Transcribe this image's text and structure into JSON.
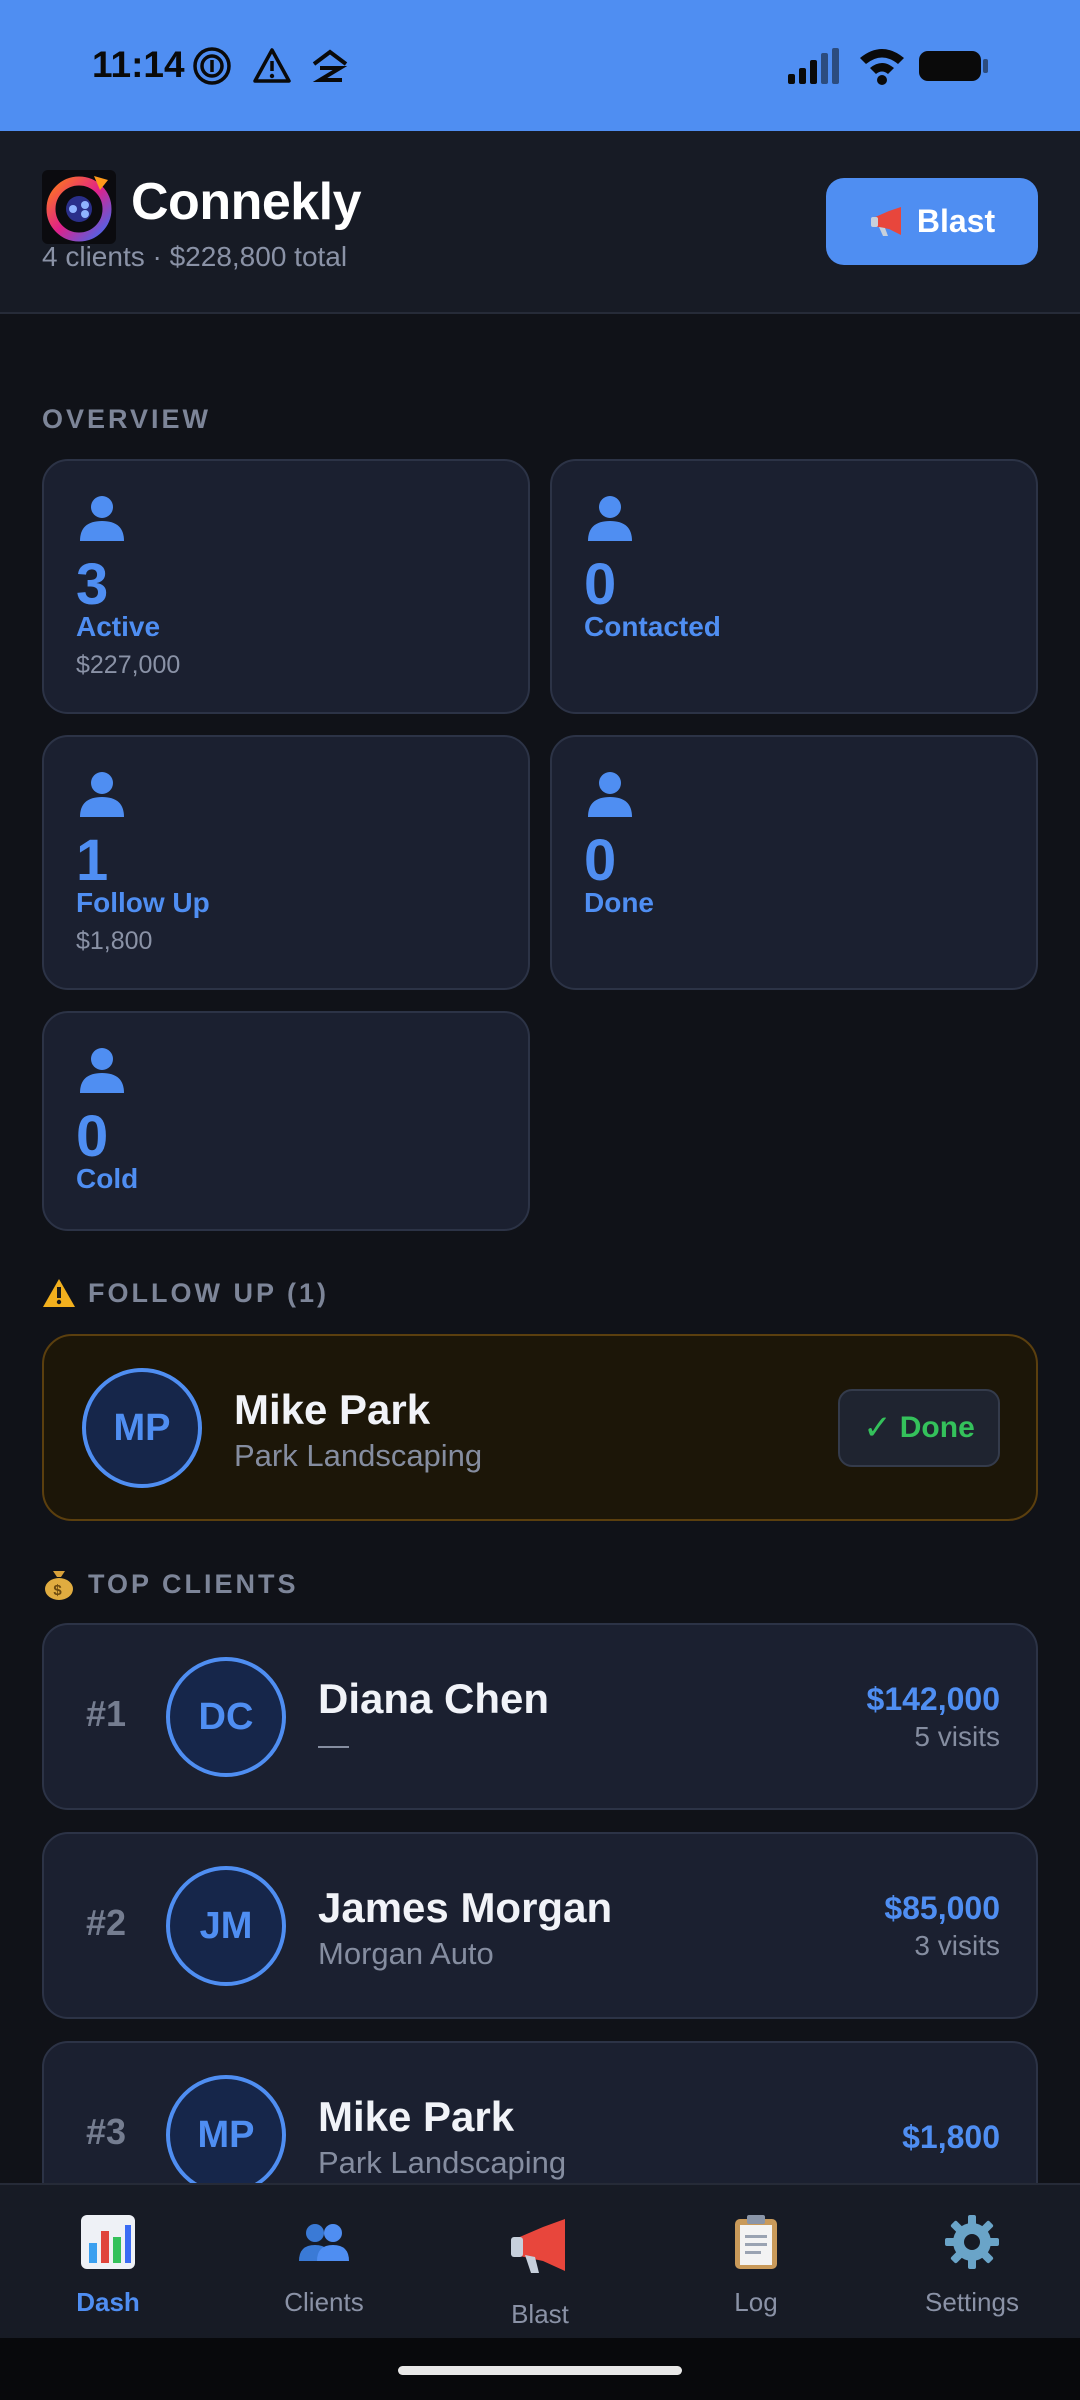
{
  "status_bar": {
    "time": "11:14"
  },
  "header": {
    "title": "Connekly",
    "subtitle": "4 clients · $228,800 total",
    "blast_label": "Blast"
  },
  "overview": {
    "label": "OVERVIEW",
    "stats": [
      {
        "count": "3",
        "label": "Active",
        "sub": "$227,000"
      },
      {
        "count": "0",
        "label": "Contacted",
        "sub": ""
      },
      {
        "count": "1",
        "label": "Follow Up",
        "sub": "$1,800"
      },
      {
        "count": "0",
        "label": "Done",
        "sub": ""
      },
      {
        "count": "0",
        "label": "Cold",
        "sub": ""
      }
    ]
  },
  "follow_up": {
    "label": "FOLLOW UP (1)",
    "item": {
      "initials": "MP",
      "name": "Mike Park",
      "company": "Park Landscaping",
      "done_label": "Done"
    }
  },
  "top_clients": {
    "label": "TOP CLIENTS",
    "items": [
      {
        "rank": "#1",
        "initials": "DC",
        "name": "Diana Chen",
        "company": "—",
        "amount": "$142,000",
        "visits": "5 visits"
      },
      {
        "rank": "#2",
        "initials": "JM",
        "name": "James Morgan",
        "company": "Morgan Auto",
        "amount": "$85,000",
        "visits": "3 visits"
      },
      {
        "rank": "#3",
        "initials": "MP",
        "name": "Mike Park",
        "company": "Park Landscaping",
        "amount": "$1,800",
        "visits": ""
      }
    ]
  },
  "nav": [
    {
      "label": "Dash",
      "icon": "bar-chart-icon",
      "active": true
    },
    {
      "label": "Clients",
      "icon": "people-icon",
      "active": false
    },
    {
      "label": "Blast",
      "icon": "megaphone-icon",
      "active": false
    },
    {
      "label": "Log",
      "icon": "clipboard-icon",
      "active": false
    },
    {
      "label": "Settings",
      "icon": "gear-icon",
      "active": false
    }
  ],
  "colors": {
    "accent": "#4f8ef2",
    "background": "#101218",
    "card": "#1b2030",
    "done_green": "#34c15b",
    "warning_amber": "#f2b01e"
  }
}
